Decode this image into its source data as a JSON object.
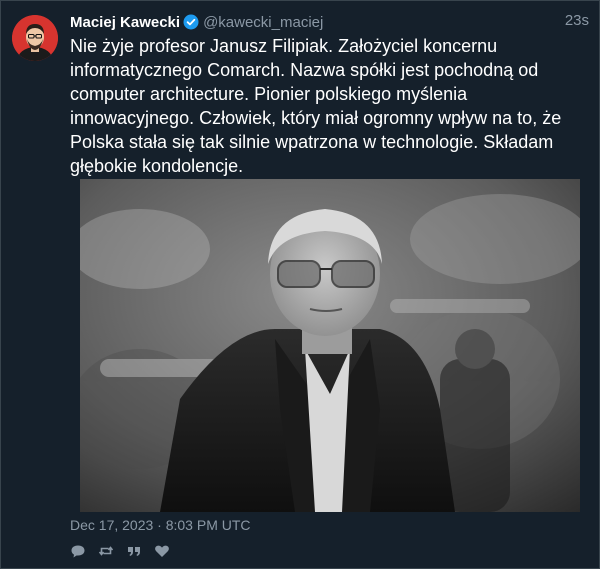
{
  "tweet": {
    "author_name": "Maciej Kawecki",
    "author_handle": "@kawecki_maciej",
    "relative_time": "23s",
    "text": "Nie żyje profesor Janusz Filipiak. Założyciel koncernu informatycznego Comarch. Nazwa spółki jest pochodną od computer architecture. Pionier polskiego myślenia innowacyjnego. Człowiek, który miał ogromny wpływ na to, że Polska stała się tak silnie wpatrzona w technologie. Składam głębokie kondolencje.",
    "timestamp": "Dec 17, 2023 · 8:03 PM UTC",
    "verified": true
  },
  "icons": {
    "verified": "verified-badge-icon",
    "reply": "reply-icon",
    "retweet": "retweet-icon",
    "quote": "quote-icon",
    "like": "heart-icon"
  },
  "colors": {
    "background": "#15202b",
    "border": "#38444d",
    "text": "#ffffff",
    "muted": "#8b98a5",
    "verified_blue": "#1d9bf0"
  }
}
